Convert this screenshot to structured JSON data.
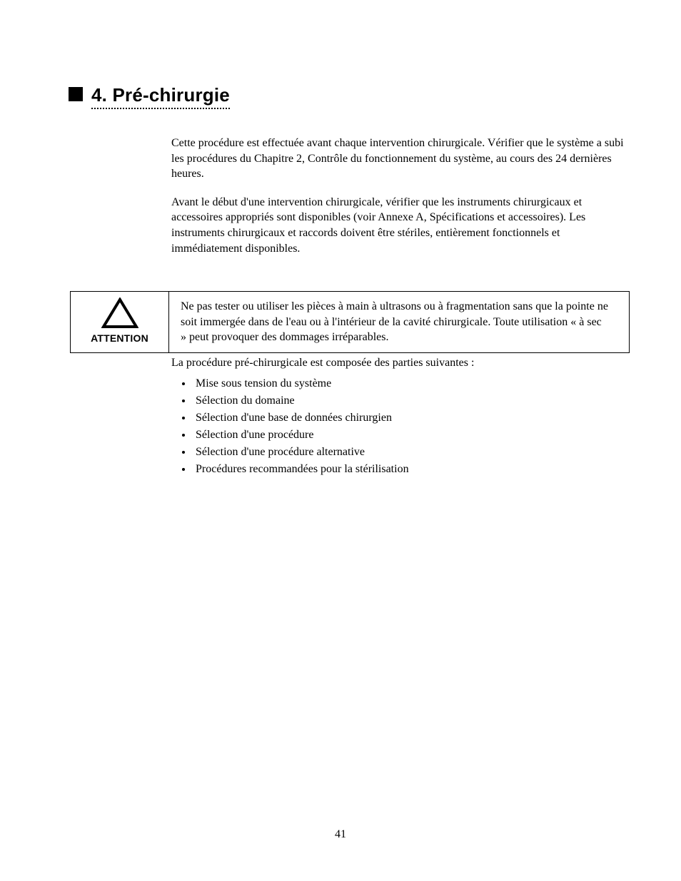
{
  "chapter": {
    "title": "4.  Pré-chirurgie"
  },
  "intro": {
    "para1": "Cette procédure est effectuée avant chaque intervention chirurgicale. Vérifier que le système a subi les procédures du Chapitre 2, Contrôle du fonctionnement du système, au cours des 24 dernières heures.",
    "para2": "Avant le début d'une intervention chirurgicale, vérifier que les instruments chirurgicaux et accessoires appropriés sont disponibles (voir Annexe A, Spécifications et accessoires). Les instruments chirurgicaux et raccords doivent être stériles, entièrement fonctionnels et immédiatement disponibles."
  },
  "caution": {
    "attention_label": "ATTENTION",
    "text": "Ne pas tester ou utiliser les pièces à main à ultrasons ou à fragmentation sans que la pointe ne soit immergée dans de l'eau ou à l'intérieur de la cavité chirurgicale. Toute utilisation « à sec » peut provoquer des dommages irréparables."
  },
  "procedure": {
    "intro": "La procédure pré-chirurgicale est composée des parties suivantes :",
    "items": [
      "Mise sous tension du système",
      "Sélection du domaine",
      "Sélection d'une base de données chirurgien",
      "Sélection d'une procédure",
      "Sélection d'une procédure alternative",
      "Procédures recommandées pour la stérilisation"
    ]
  },
  "footer": {
    "page_label": "41"
  }
}
